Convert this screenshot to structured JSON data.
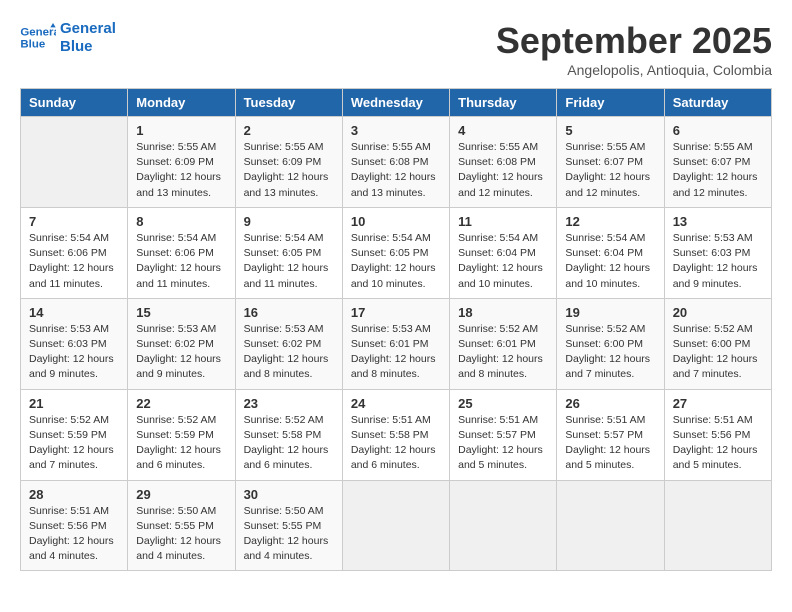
{
  "header": {
    "logo_general": "General",
    "logo_blue": "Blue",
    "month": "September 2025",
    "location": "Angelopolis, Antioquia, Colombia"
  },
  "weekdays": [
    "Sunday",
    "Monday",
    "Tuesday",
    "Wednesday",
    "Thursday",
    "Friday",
    "Saturday"
  ],
  "weeks": [
    [
      {
        "day": "",
        "info": ""
      },
      {
        "day": "1",
        "info": "Sunrise: 5:55 AM\nSunset: 6:09 PM\nDaylight: 12 hours\nand 13 minutes."
      },
      {
        "day": "2",
        "info": "Sunrise: 5:55 AM\nSunset: 6:09 PM\nDaylight: 12 hours\nand 13 minutes."
      },
      {
        "day": "3",
        "info": "Sunrise: 5:55 AM\nSunset: 6:08 PM\nDaylight: 12 hours\nand 13 minutes."
      },
      {
        "day": "4",
        "info": "Sunrise: 5:55 AM\nSunset: 6:08 PM\nDaylight: 12 hours\nand 12 minutes."
      },
      {
        "day": "5",
        "info": "Sunrise: 5:55 AM\nSunset: 6:07 PM\nDaylight: 12 hours\nand 12 minutes."
      },
      {
        "day": "6",
        "info": "Sunrise: 5:55 AM\nSunset: 6:07 PM\nDaylight: 12 hours\nand 12 minutes."
      }
    ],
    [
      {
        "day": "7",
        "info": "Sunrise: 5:54 AM\nSunset: 6:06 PM\nDaylight: 12 hours\nand 11 minutes."
      },
      {
        "day": "8",
        "info": "Sunrise: 5:54 AM\nSunset: 6:06 PM\nDaylight: 12 hours\nand 11 minutes."
      },
      {
        "day": "9",
        "info": "Sunrise: 5:54 AM\nSunset: 6:05 PM\nDaylight: 12 hours\nand 11 minutes."
      },
      {
        "day": "10",
        "info": "Sunrise: 5:54 AM\nSunset: 6:05 PM\nDaylight: 12 hours\nand 10 minutes."
      },
      {
        "day": "11",
        "info": "Sunrise: 5:54 AM\nSunset: 6:04 PM\nDaylight: 12 hours\nand 10 minutes."
      },
      {
        "day": "12",
        "info": "Sunrise: 5:54 AM\nSunset: 6:04 PM\nDaylight: 12 hours\nand 10 minutes."
      },
      {
        "day": "13",
        "info": "Sunrise: 5:53 AM\nSunset: 6:03 PM\nDaylight: 12 hours\nand 9 minutes."
      }
    ],
    [
      {
        "day": "14",
        "info": "Sunrise: 5:53 AM\nSunset: 6:03 PM\nDaylight: 12 hours\nand 9 minutes."
      },
      {
        "day": "15",
        "info": "Sunrise: 5:53 AM\nSunset: 6:02 PM\nDaylight: 12 hours\nand 9 minutes."
      },
      {
        "day": "16",
        "info": "Sunrise: 5:53 AM\nSunset: 6:02 PM\nDaylight: 12 hours\nand 8 minutes."
      },
      {
        "day": "17",
        "info": "Sunrise: 5:53 AM\nSunset: 6:01 PM\nDaylight: 12 hours\nand 8 minutes."
      },
      {
        "day": "18",
        "info": "Sunrise: 5:52 AM\nSunset: 6:01 PM\nDaylight: 12 hours\nand 8 minutes."
      },
      {
        "day": "19",
        "info": "Sunrise: 5:52 AM\nSunset: 6:00 PM\nDaylight: 12 hours\nand 7 minutes."
      },
      {
        "day": "20",
        "info": "Sunrise: 5:52 AM\nSunset: 6:00 PM\nDaylight: 12 hours\nand 7 minutes."
      }
    ],
    [
      {
        "day": "21",
        "info": "Sunrise: 5:52 AM\nSunset: 5:59 PM\nDaylight: 12 hours\nand 7 minutes."
      },
      {
        "day": "22",
        "info": "Sunrise: 5:52 AM\nSunset: 5:59 PM\nDaylight: 12 hours\nand 6 minutes."
      },
      {
        "day": "23",
        "info": "Sunrise: 5:52 AM\nSunset: 5:58 PM\nDaylight: 12 hours\nand 6 minutes."
      },
      {
        "day": "24",
        "info": "Sunrise: 5:51 AM\nSunset: 5:58 PM\nDaylight: 12 hours\nand 6 minutes."
      },
      {
        "day": "25",
        "info": "Sunrise: 5:51 AM\nSunset: 5:57 PM\nDaylight: 12 hours\nand 5 minutes."
      },
      {
        "day": "26",
        "info": "Sunrise: 5:51 AM\nSunset: 5:57 PM\nDaylight: 12 hours\nand 5 minutes."
      },
      {
        "day": "27",
        "info": "Sunrise: 5:51 AM\nSunset: 5:56 PM\nDaylight: 12 hours\nand 5 minutes."
      }
    ],
    [
      {
        "day": "28",
        "info": "Sunrise: 5:51 AM\nSunset: 5:56 PM\nDaylight: 12 hours\nand 4 minutes."
      },
      {
        "day": "29",
        "info": "Sunrise: 5:50 AM\nSunset: 5:55 PM\nDaylight: 12 hours\nand 4 minutes."
      },
      {
        "day": "30",
        "info": "Sunrise: 5:50 AM\nSunset: 5:55 PM\nDaylight: 12 hours\nand 4 minutes."
      },
      {
        "day": "",
        "info": ""
      },
      {
        "day": "",
        "info": ""
      },
      {
        "day": "",
        "info": ""
      },
      {
        "day": "",
        "info": ""
      }
    ]
  ]
}
